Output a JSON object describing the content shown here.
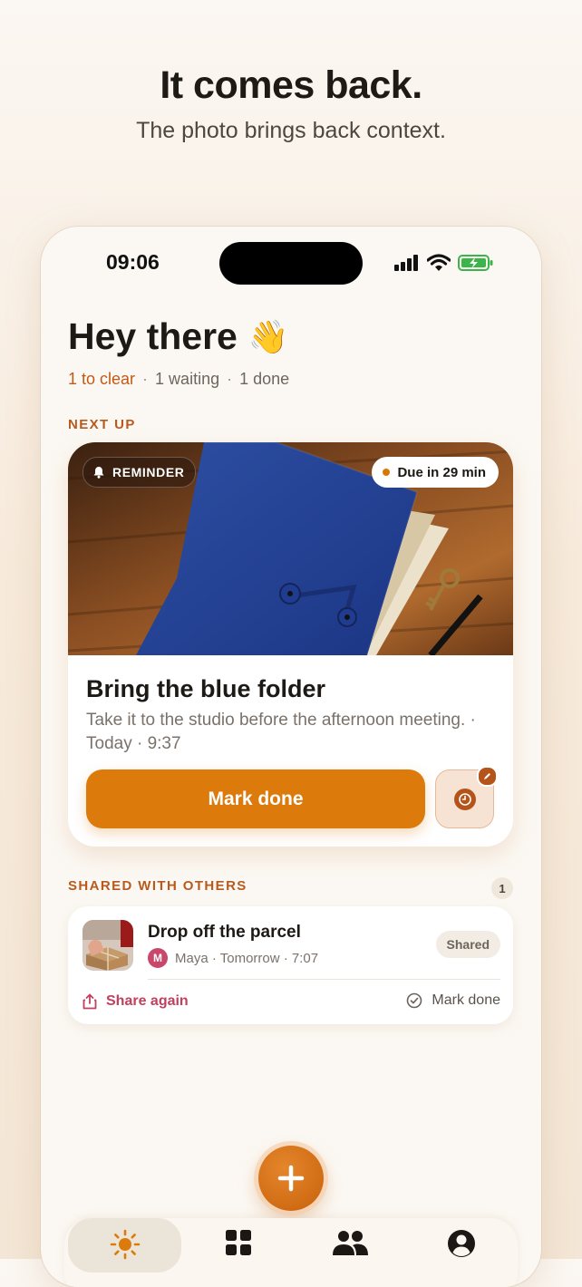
{
  "marketing": {
    "headline": "It comes back.",
    "subhead": "The photo brings back context."
  },
  "status_bar": {
    "time": "09:06",
    "icons": [
      "cellular-signal-icon",
      "wifi-icon",
      "battery-charging-icon"
    ]
  },
  "home": {
    "greeting": "Hey there",
    "greeting_emoji": "👋",
    "summary": {
      "to_clear": "1 to clear",
      "waiting": "1 waiting",
      "done": "1 done",
      "separator": "·"
    }
  },
  "next_up": {
    "section_label": "NEXT UP",
    "chip_label": "REMINDER",
    "due_label": "Due in 29 min",
    "title": "Bring the blue folder",
    "description": "Take it to the studio before the afternoon meeting. · Today · 9:37",
    "primary_action": "Mark done"
  },
  "shared": {
    "section_label": "SHARED WITH OTHERS",
    "count": "1",
    "item": {
      "title": "Drop off the parcel",
      "avatar_initial": "M",
      "meta": "Maya · Tomorrow · 7:07",
      "tag": "Shared",
      "share_again": "Share again",
      "mark_done": "Mark done"
    }
  },
  "tabbar": {
    "tabs": [
      "sun-icon",
      "grid-icon",
      "people-icon",
      "profile-icon"
    ],
    "active_index": 0
  },
  "colors": {
    "accent": "#dc7a0c",
    "accent_text": "#c25a14",
    "share_text": "#c0405f"
  }
}
